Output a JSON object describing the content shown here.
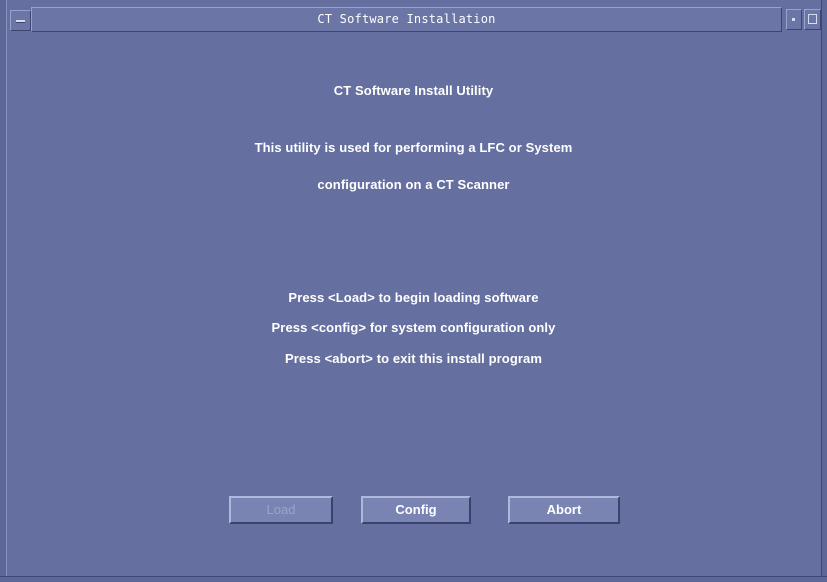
{
  "window": {
    "title": "CT Software Installation"
  },
  "content": {
    "heading": "CT Software Install Utility",
    "description_line1": "This utility is used for performing a LFC or System",
    "description_line2": "configuration on a CT Scanner",
    "instruction_load": "Press <Load> to begin loading software",
    "instruction_config": "Press <config> for system configuration only",
    "instruction_abort": "Press <abort> to exit this install program"
  },
  "buttons": {
    "load_label": "Load",
    "load_enabled": false,
    "config_label": "Config",
    "abort_label": "Abort"
  },
  "colors": {
    "background": "#6670a0",
    "text": "#ffffff",
    "button_face": "#7a84b3",
    "disabled_text": "#9aa3cc"
  }
}
